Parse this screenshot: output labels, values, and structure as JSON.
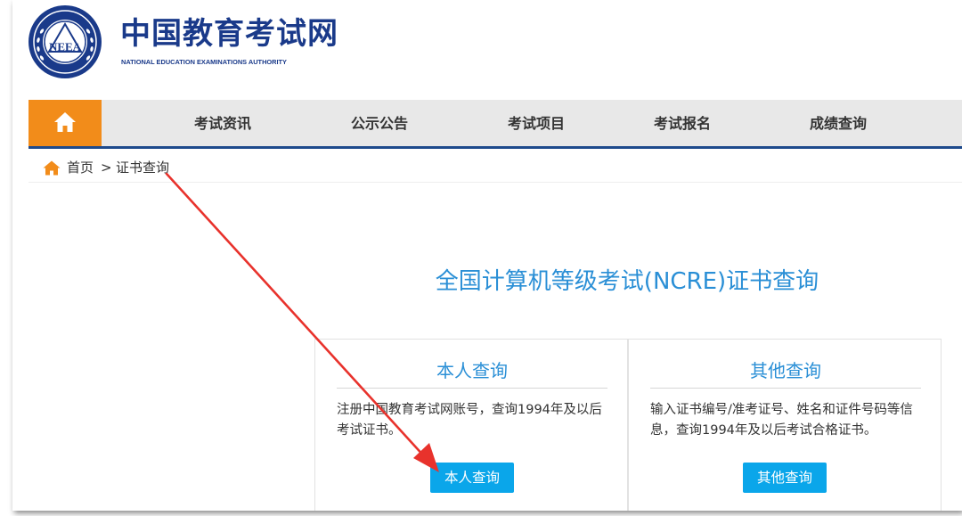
{
  "header": {
    "site_name": "中国教育考试网",
    "site_subtitle": "NATIONAL EDUCATION EXAMINATIONS AUTHORITY",
    "logo_text": "NEEA",
    "brand_color": "#1a3a8a"
  },
  "nav": {
    "home_icon": "home-icon",
    "home_color": "#f28c1a",
    "items": [
      {
        "label": "考试资讯"
      },
      {
        "label": "公示公告"
      },
      {
        "label": "考试项目"
      },
      {
        "label": "考试报名"
      },
      {
        "label": "成绩查询"
      }
    ]
  },
  "breadcrumb": {
    "home_label": "首页",
    "separator": ">",
    "current": "证书查询"
  },
  "main": {
    "title": "全国计算机等级考试(NCRE)证书查询",
    "accent_color": "#2a8fd6",
    "button_color": "#0aa6ea",
    "cards": [
      {
        "title": "本人查询",
        "description": "注册中国教育考试网账号，查询1994年及以后考试证书。",
        "button_label": "本人查询"
      },
      {
        "title": "其他查询",
        "description": "输入证书编号/准考证号、姓名和证件号码等信息，查询1994年及以后考试合格证书。",
        "button_label": "其他查询"
      }
    ]
  },
  "annotation": {
    "arrow_color": "#e8322c"
  }
}
